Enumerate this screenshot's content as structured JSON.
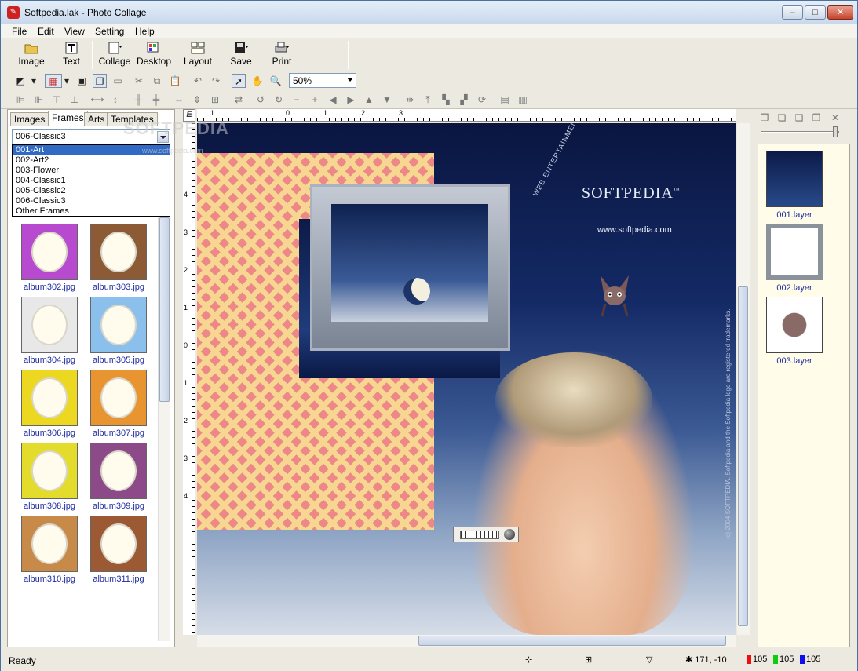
{
  "window": {
    "title": "Softpedia.lak - Photo Collage",
    "controls": {
      "minimize": "–",
      "maximize": "□",
      "close": "✕"
    }
  },
  "menu": [
    "File",
    "Edit",
    "View",
    "Setting",
    "Help"
  ],
  "toolbar_main": [
    {
      "label": "Image",
      "icon": "folder-open-icon"
    },
    {
      "label": "Text",
      "icon": "text-icon"
    },
    {
      "label": "Collage",
      "icon": "collage-icon"
    },
    {
      "label": "Desktop",
      "icon": "desktop-icon"
    },
    {
      "label": "Layout",
      "icon": "layout-icon"
    },
    {
      "label": "Save",
      "icon": "floppy-icon"
    },
    {
      "label": "Print",
      "icon": "printer-icon"
    }
  ],
  "toolbar_edit": {
    "zoom_value": "50%"
  },
  "left_panel": {
    "tabs": [
      "Images",
      "Frames",
      "Arts",
      "Templates"
    ],
    "active_tab": "Frames",
    "combo_value": "006-Classic3",
    "dropdown_options": [
      "001-Art",
      "002-Art2",
      "003-Flower",
      "004-Classic1",
      "005-Classic2",
      "006-Classic3",
      "Other Frames"
    ],
    "dropdown_selected": "001-Art",
    "thumbnails": [
      {
        "name": "album302.jpg",
        "color": "#b84ad0"
      },
      {
        "name": "album303.jpg",
        "color": "#8c5a34"
      },
      {
        "name": "album304.jpg",
        "color": "#e8e8e8"
      },
      {
        "name": "album305.jpg",
        "color": "#8cc0ec"
      },
      {
        "name": "album306.jpg",
        "color": "#ecd820"
      },
      {
        "name": "album307.jpg",
        "color": "#e89430"
      },
      {
        "name": "album308.jpg",
        "color": "#e4dc2c"
      },
      {
        "name": "album309.jpg",
        "color": "#8c4a88"
      },
      {
        "name": "album310.jpg",
        "color": "#c88a48"
      },
      {
        "name": "album311.jpg",
        "color": "#9c5a34"
      }
    ],
    "watermark": "SOFTPEDIA",
    "watermark_url": "www.softpedia.com"
  },
  "canvas": {
    "brand": "SOFTPEDIA",
    "brand_tm": "™",
    "url": "www.softpedia.com",
    "tagline": "WEB ENTERTAINMENT",
    "copyright": "(c) 2004 SOFTPEDIA. Softpedia and the Softpedia logo are registered trademarks."
  },
  "ruler": {
    "top_labels": [
      "1",
      "0",
      "1",
      "2",
      "3"
    ],
    "left_labels": [
      "4",
      "3",
      "2",
      "1",
      "0",
      "1",
      "2",
      "3",
      "4"
    ],
    "corner": "E"
  },
  "layers": [
    {
      "name": "001.layer"
    },
    {
      "name": "002.layer"
    },
    {
      "name": "003.layer"
    }
  ],
  "status": {
    "text": "Ready",
    "coords": "171, -10",
    "red": "105",
    "green": "105",
    "blue": "105",
    "colors": {
      "red": "#ee1010",
      "green": "#10cc10",
      "blue": "#1010ee"
    }
  }
}
